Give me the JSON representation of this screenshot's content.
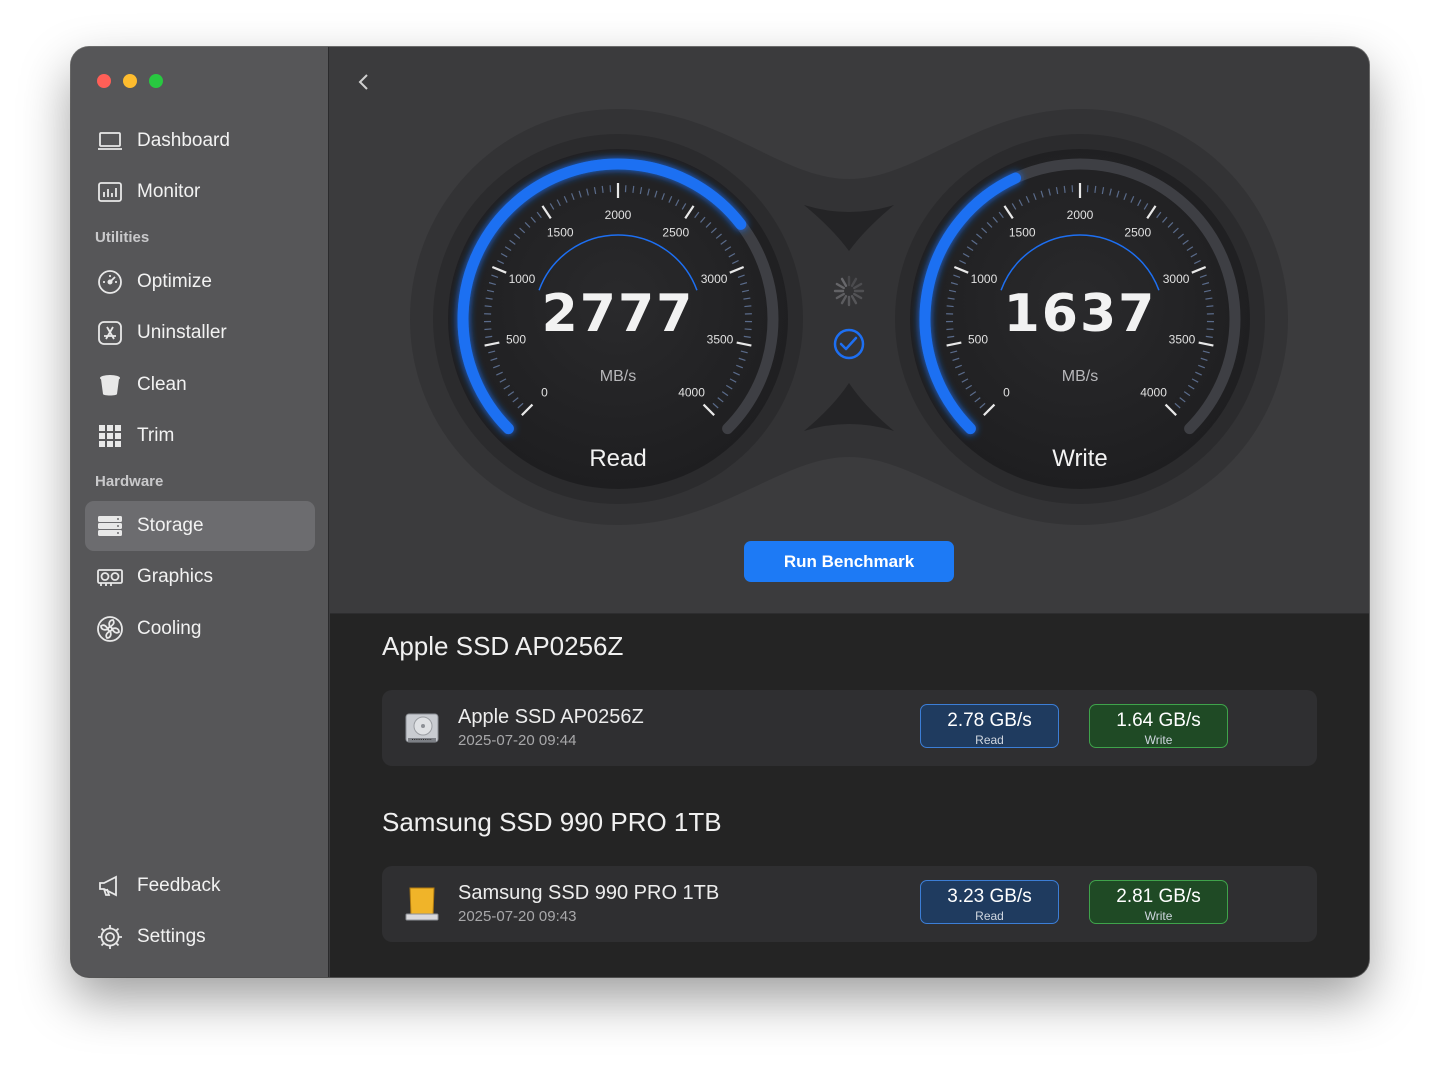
{
  "window": {
    "traffic_lights": [
      "close",
      "minimize",
      "zoom"
    ]
  },
  "sidebar": {
    "items_top": [
      {
        "label": "Dashboard",
        "icon": "laptop-icon"
      },
      {
        "label": "Monitor",
        "icon": "chart-icon"
      }
    ],
    "utilities_label": "Utilities",
    "utilities": [
      {
        "label": "Optimize",
        "icon": "speedometer-icon"
      },
      {
        "label": "Uninstaller",
        "icon": "app-store-icon"
      },
      {
        "label": "Clean",
        "icon": "bin-icon"
      },
      {
        "label": "Trim",
        "icon": "grid-icon"
      }
    ],
    "hardware_label": "Hardware",
    "hardware": [
      {
        "label": "Storage",
        "icon": "storage-icon",
        "active": true
      },
      {
        "label": "Graphics",
        "icon": "graphics-card-icon"
      },
      {
        "label": "Cooling",
        "icon": "fan-icon"
      }
    ],
    "bottom": [
      {
        "label": "Feedback",
        "icon": "megaphone-icon"
      },
      {
        "label": "Settings",
        "icon": "gear-icon"
      }
    ]
  },
  "gauges": {
    "ticks": [
      "0",
      "500",
      "1000",
      "1500",
      "2000",
      "2500",
      "3000",
      "3500",
      "4000"
    ],
    "max": 4000,
    "read": {
      "value": "2777",
      "unit": "MB/s",
      "label": "Read",
      "fraction": 0.694
    },
    "write": {
      "value": "1637",
      "unit": "MB/s",
      "label": "Write",
      "fraction": 0.409
    },
    "accent": "#1d6ff2"
  },
  "run_button": "Run Benchmark",
  "devices": [
    {
      "section_title": "Apple SSD AP0256Z",
      "name": "Apple SSD AP0256Z",
      "date": "2025-07-20 09:44",
      "read": "2.78 GB/s",
      "read_label": "Read",
      "write": "1.64 GB/s",
      "write_label": "Write",
      "icon": "internal-drive-icon"
    },
    {
      "section_title": "Samsung SSD 990 PRO 1TB",
      "name": "Samsung SSD 990 PRO 1TB",
      "date": "2025-07-20 09:43",
      "read": "3.23 GB/s",
      "read_label": "Read",
      "write": "2.81 GB/s",
      "write_label": "Write",
      "icon": "external-drive-icon"
    }
  ]
}
